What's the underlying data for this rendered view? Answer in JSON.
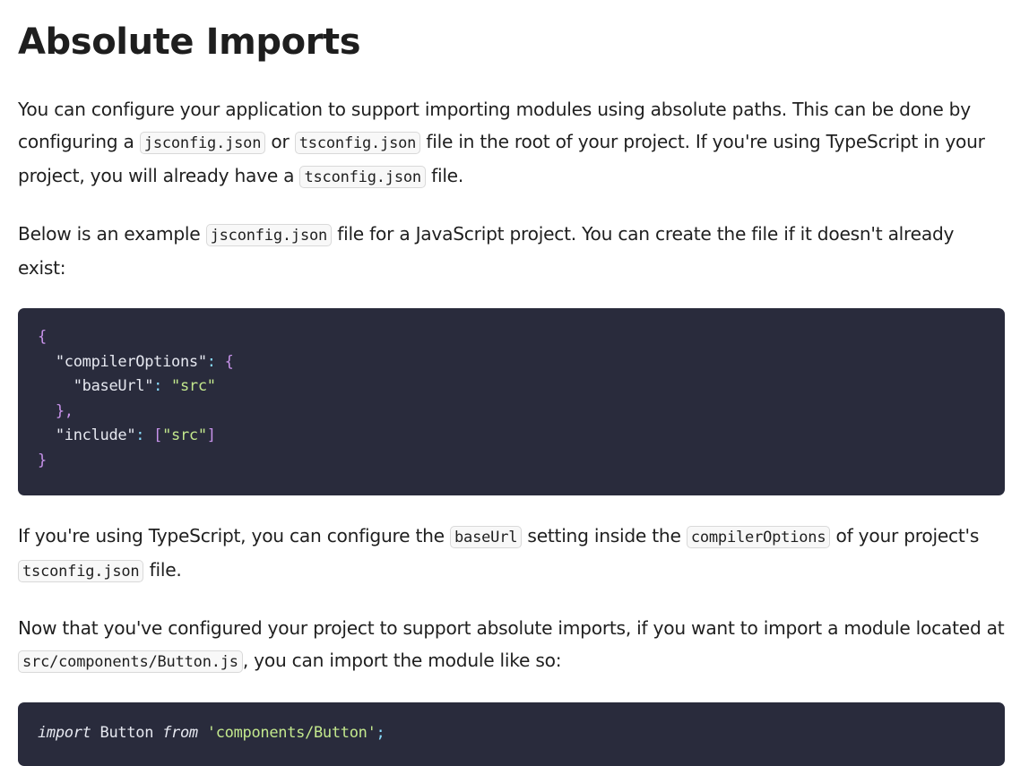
{
  "title": "Absolute Imports",
  "p1": {
    "t1": "You can configure your application to support importing modules using absolute paths. This can be done by configuring a ",
    "c1": "jsconfig.json",
    "t2": " or ",
    "c2": "tsconfig.json",
    "t3": " file in the root of your project. If you're using TypeScript in your project, you will already have a ",
    "c3": "tsconfig.json",
    "t4": " file."
  },
  "p2": {
    "t1": "Below is an example ",
    "c1": "jsconfig.json",
    "t2": " file for a JavaScript project. You can create the file if it doesn't already exist:"
  },
  "code1": {
    "open": "{",
    "key1": "\"compilerOptions\"",
    "colon1": ": ",
    "open2": "{",
    "key2": "\"baseUrl\"",
    "colon2": ": ",
    "val2": "\"src\"",
    "close2": "},",
    "key3": "\"include\"",
    "colon3": ": ",
    "arr_open": "[",
    "val3": "\"src\"",
    "arr_close": "]",
    "close": "}"
  },
  "p3": {
    "t1": "If you're using TypeScript, you can configure the ",
    "c1": "baseUrl",
    "t2": " setting inside the ",
    "c2": "compilerOptions",
    "t3": " of your project's ",
    "c3": "tsconfig.json",
    "t4": " file."
  },
  "p4": {
    "t1": "Now that you've configured your project to support absolute imports, if you want to import a module located at ",
    "c1": "src/components/Button.js",
    "t2": ", you can import the module like so:"
  },
  "code2": {
    "kw1": "import",
    "id": " Button ",
    "kw2": "from",
    "sp": " ",
    "str": "'components/Button'",
    "semi": ";"
  }
}
